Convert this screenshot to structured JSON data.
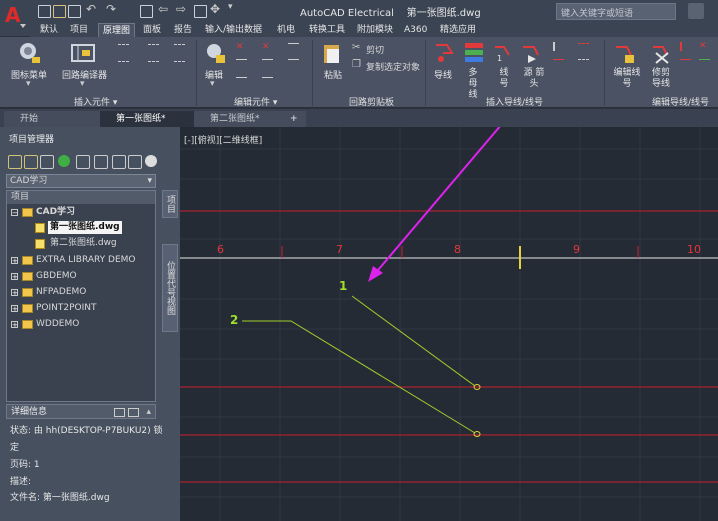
{
  "app": {
    "title": "AutoCAD Electrical",
    "document": "第一张图纸.dwg",
    "search_placeholder": "键入关键字或短语"
  },
  "ribbon_tabs": [
    "默认",
    "项目",
    "原理图",
    "面板",
    "报告",
    "输入/输出数据",
    "机电",
    "转换工具",
    "附加模块",
    "A360",
    "精选应用"
  ],
  "ribbon_active_tab": "原理图",
  "ribbon_panels": [
    {
      "label": "插入元件 ▾",
      "buttons": [
        "图标菜单",
        "回路编译器"
      ]
    },
    {
      "label": "编辑元件 ▾",
      "buttons": [
        "编辑"
      ]
    },
    {
      "label": "回路剪贴板",
      "buttons": [
        "粘贴",
        "剪切",
        "复制选定对象"
      ]
    },
    {
      "label": "插入导线/线号",
      "buttons": [
        "导线",
        "多 母线",
        "线 号",
        "源 箭头"
      ]
    },
    {
      "label": "编辑导线/线号",
      "buttons": [
        "编辑线 号",
        "修剪 导线"
      ]
    }
  ],
  "doc_tabs": [
    "开始",
    "第一张图纸*",
    "第二张图纸*"
  ],
  "doc_tab_active": "第一张图纸*",
  "project_manager": {
    "title": "项目管理器",
    "selected_project": "CAD学习",
    "tree_header": "项目",
    "tree": [
      {
        "label": "CAD学习",
        "level": 0,
        "expanded": true,
        "bold": true
      },
      {
        "label": "第一张图纸.dwg",
        "level": 1,
        "selected": true
      },
      {
        "label": "第二张图纸.dwg",
        "level": 1
      },
      {
        "label": "EXTRA LIBRARY DEMO",
        "level": 0
      },
      {
        "label": "GBDEMO",
        "level": 0
      },
      {
        "label": "NFPADEMO",
        "level": 0
      },
      {
        "label": "POINT2POINT",
        "level": 0
      },
      {
        "label": "WDDEMO",
        "level": 0
      }
    ],
    "side_tabs": [
      "项目",
      "位置代号视图"
    ]
  },
  "details": {
    "title": "详细信息",
    "status": "状态: 由 hh(DESKTOP-P7BUKU2) 锁",
    "status2": "定",
    "page": "页码: 1",
    "description": "描述:",
    "filename": "文件名: 第一张图纸.dwg"
  },
  "drawing": {
    "view_label": "[-][俯视][二维线框]",
    "ladder_numbers": [
      "6",
      "7",
      "8",
      "9",
      "10"
    ],
    "annotations": [
      "1",
      "2"
    ]
  },
  "colors": {
    "annotation_arrow": "#dd22ee",
    "ladder_line": "#c8202a",
    "wire_line": "#9fcf2b",
    "background": "#252b35"
  }
}
